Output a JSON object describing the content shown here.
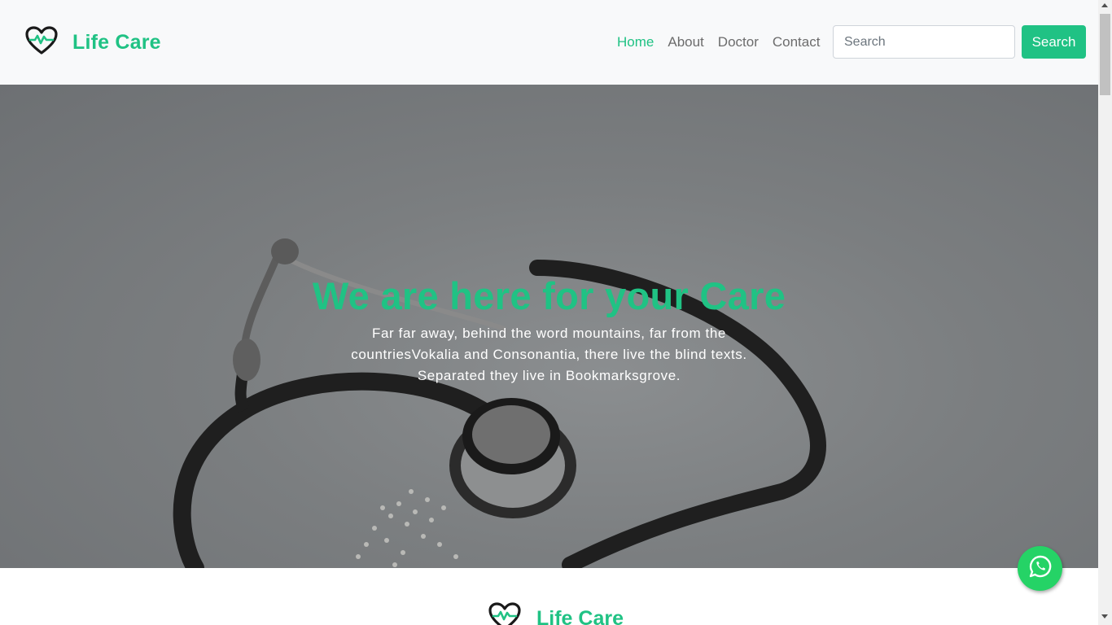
{
  "nav": {
    "brand": "Life Care",
    "links": [
      {
        "label": "Home",
        "active": true
      },
      {
        "label": "About",
        "active": false
      },
      {
        "label": "Doctor",
        "active": false
      },
      {
        "label": "Contact",
        "active": false
      }
    ],
    "search_placeholder": "Search",
    "search_button": "Search"
  },
  "hero": {
    "title": "We are here for your Care",
    "text": "Far far away, behind the word mountains, far from the countriesVokalia and Consonantia, there live the blind texts. Separated they live in Bookmarksgrove."
  },
  "footer": {
    "brand": "Life Care"
  },
  "colors": {
    "accent": "#20c284",
    "whatsapp": "#25d366",
    "navbar_bg": "#f8f9fa"
  },
  "icons": {
    "brand": "heart-pulse-icon",
    "floating": "whatsapp-icon"
  }
}
